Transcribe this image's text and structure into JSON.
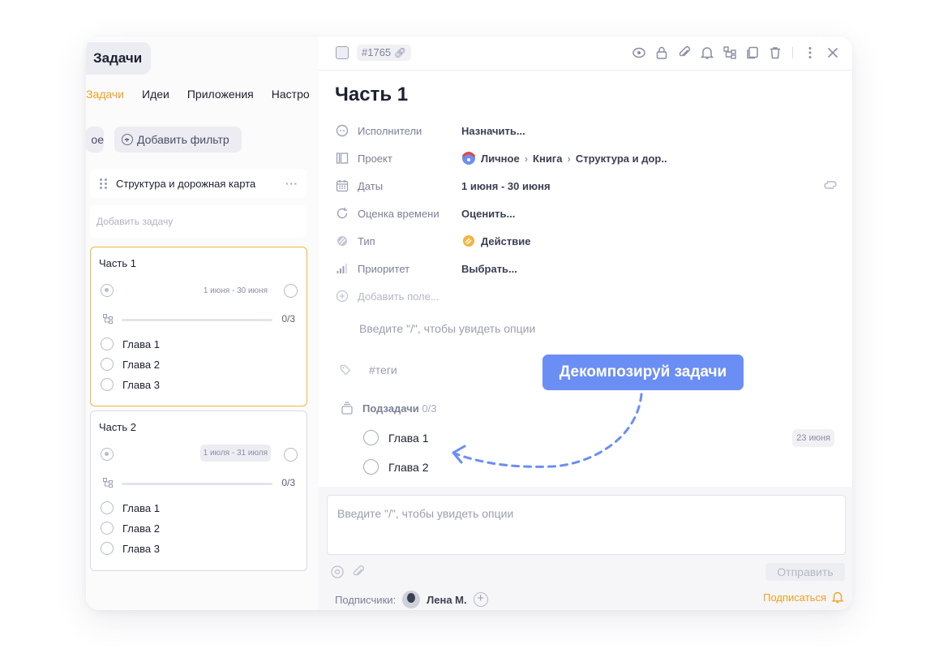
{
  "board": {
    "title": "Задачи",
    "tabs": [
      "Задачи",
      "Идеи",
      "Приложения",
      "Настро"
    ],
    "filter_left": "ое",
    "add_filter": "Добавить фильтр",
    "column_title": "Структура и дорожная карта",
    "add_task_placeholder": "Добавить задачу",
    "cards": [
      {
        "title": "Часть 1",
        "dates": "1 июня - 30 июня",
        "progress_text": "0/3",
        "progress": 0,
        "subtasks": [
          "Глава 1",
          "Глава 2",
          "Глава 3"
        ]
      },
      {
        "title": "Часть 2",
        "dates": "1 июля - 31 июля",
        "progress_text": "0/3",
        "progress": 0,
        "subtasks": [
          "Глава 1",
          "Глава 2",
          "Глава 3"
        ]
      }
    ]
  },
  "task": {
    "id": "#1765",
    "title": "Часть 1",
    "fields": {
      "assignees_label": "Исполнители",
      "assignees_value": "Назначить...",
      "project_label": "Проект",
      "project_path": [
        "Личное",
        "Книга",
        "Структура и дор.."
      ],
      "dates_label": "Даты",
      "dates_value": "1 июня - 30 июня",
      "estimate_label": "Оценка времени",
      "estimate_value": "Оценить...",
      "type_label": "Тип",
      "type_value": "Действие",
      "priority_label": "Приоритет",
      "priority_value": "Выбрать...",
      "add_field": "Добавить поле..."
    },
    "editor_placeholder": "Введите \"/\", чтобы увидеть опции",
    "tags_placeholder": "#теги",
    "subtasks_label": "Подзадачи",
    "subtasks_count": "0/3",
    "subtasks": [
      "Глава 1",
      "Глава 2"
    ],
    "subtask_date": "23 июня"
  },
  "callout": "Декомпозируй задачи",
  "comments": {
    "placeholder": "Введите \"/\", чтобы увидеть опции",
    "send": "Отправить",
    "subscribers_label": "Подписчики:",
    "subscriber_name": "Лена М.",
    "subscribe": "Подписаться"
  },
  "colors": {
    "accent_orange": "#f0a020",
    "callout_blue": "#6b8ef5"
  }
}
